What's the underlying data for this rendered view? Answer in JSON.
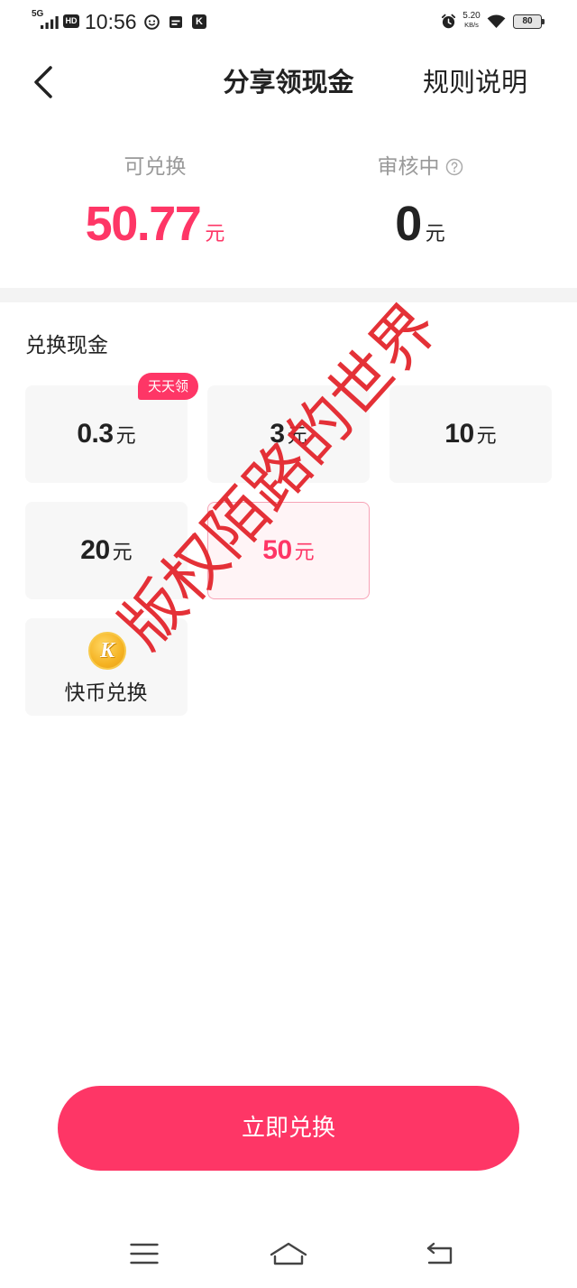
{
  "status_bar": {
    "network": "5G",
    "hd_label": "HD",
    "time": "10:56",
    "app_letter": "K",
    "speed_value": "5.20",
    "speed_unit": "KB/s",
    "battery": "80",
    "icons": [
      "signal-icon",
      "message-app-icon",
      "calendar-icon",
      "kuaishou-app-icon",
      "alarm-icon",
      "wifi-icon",
      "battery-icon"
    ]
  },
  "header": {
    "back_icon": "chevron-left-icon",
    "title": "分享领现金",
    "rules_label": "规则说明"
  },
  "balance": {
    "available_label": "可兑换",
    "available_amount": "50.77",
    "available_unit": "元",
    "pending_label": "审核中",
    "pending_help_icon": "question-circle-icon",
    "pending_amount": "0",
    "pending_unit": "元"
  },
  "exchange": {
    "section_title": "兑换现金",
    "options": [
      {
        "amount": "0.3",
        "unit": "元",
        "badge": "天天领",
        "selected": false
      },
      {
        "amount": "3",
        "unit": "元",
        "selected": false
      },
      {
        "amount": "10",
        "unit": "元",
        "selected": false
      },
      {
        "amount": "20",
        "unit": "元",
        "selected": false
      },
      {
        "amount": "50",
        "unit": "元",
        "selected": true
      }
    ],
    "coin_option": {
      "icon": "kuaibi-coin-icon",
      "icon_letter": "K",
      "label": "快币兑换"
    }
  },
  "watermark": {
    "text": "版权陌路的世界"
  },
  "action": {
    "submit_label": "立即兑换"
  },
  "nav_bar": {
    "icons": [
      "menu-icon",
      "home-icon",
      "back-icon"
    ]
  },
  "colors": {
    "accent": "#fe3666",
    "text": "#222222",
    "muted": "#999999",
    "card": "#f7f7f7",
    "band": "#f3f3f3",
    "watermark": "#e3262d",
    "selected_bg": "#fff4f6",
    "selected_border": "#f7a3b6",
    "coin": "#f5b323",
    "icon": "#444444"
  }
}
